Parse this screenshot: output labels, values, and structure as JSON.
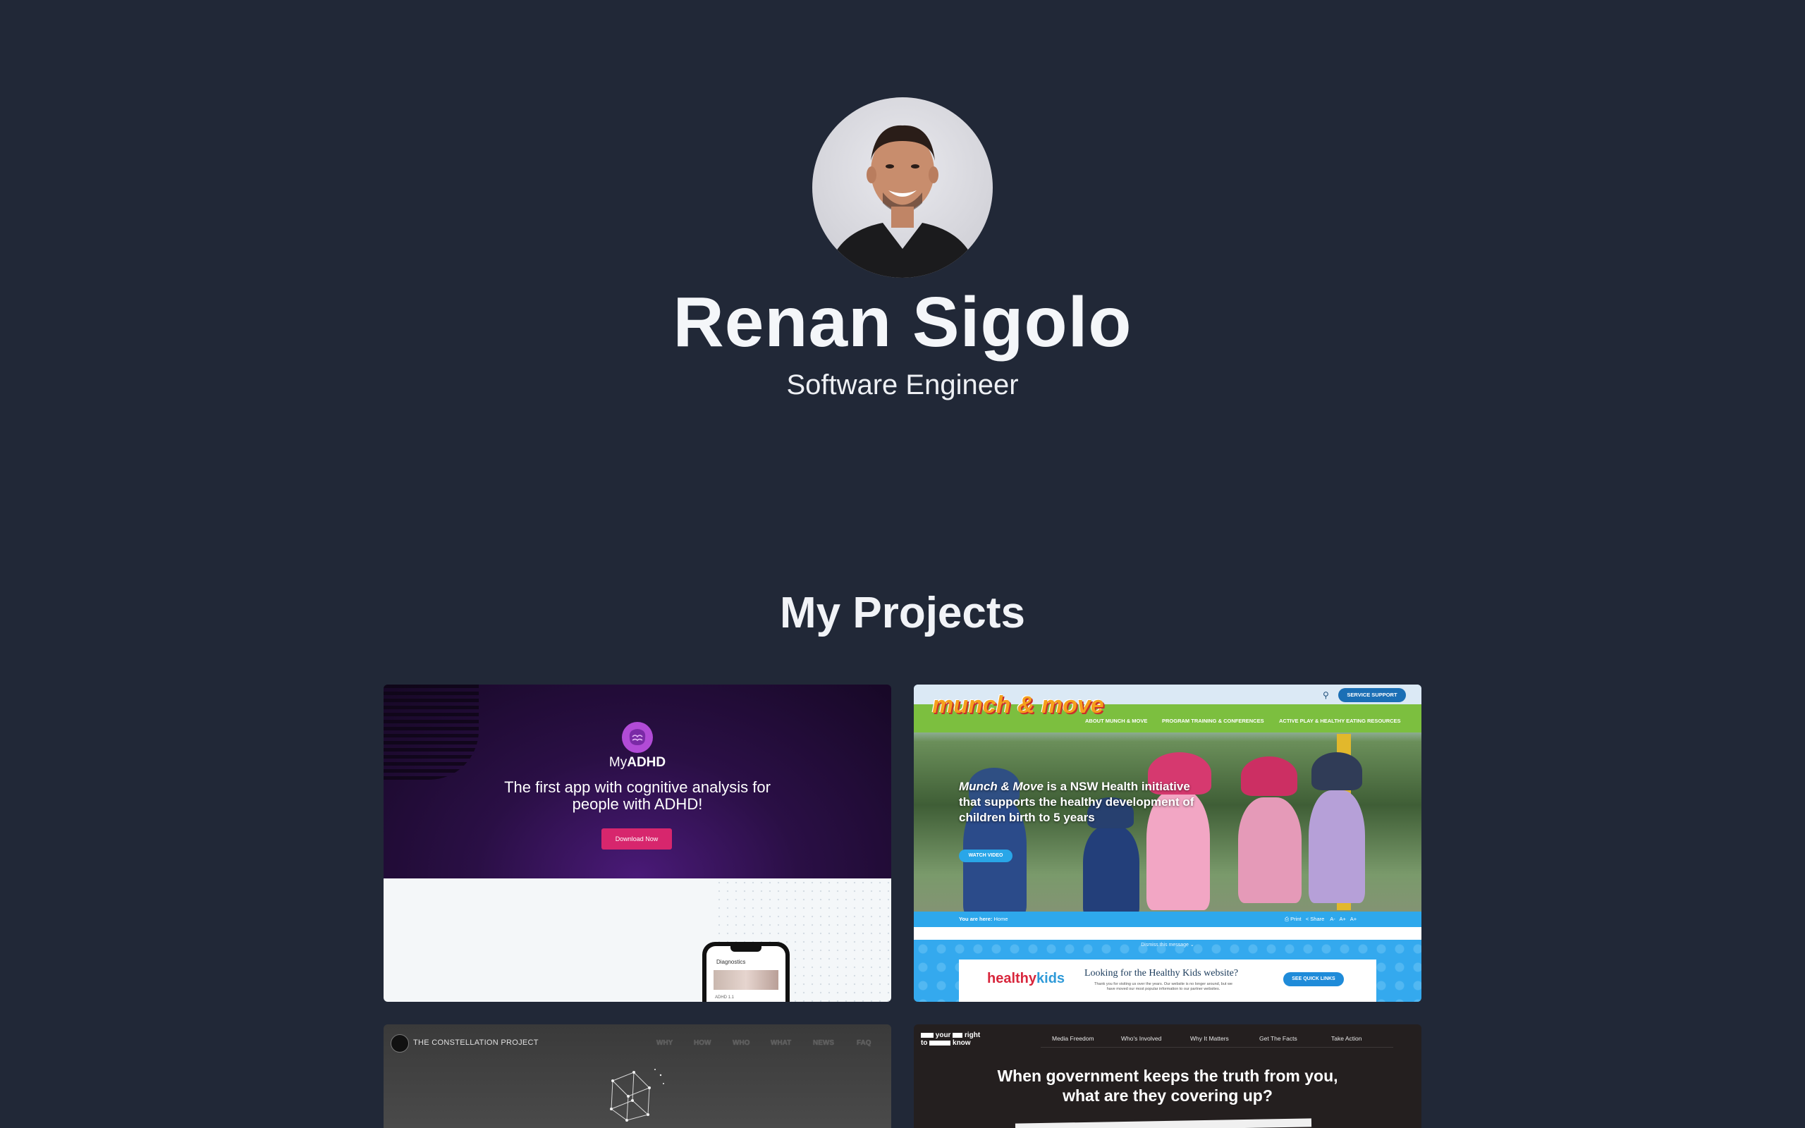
{
  "profile": {
    "name": "Renan Sigolo",
    "title": "Software Engineer",
    "avatar_icon": "portrait-photo"
  },
  "projects_section": {
    "title": "My Projects"
  },
  "projects": [
    {
      "brand_prefix": "My",
      "brand_suffix": "ADHD",
      "headline": "The first app with cognitive analysis for people with ADHD!",
      "button": "Download Now",
      "phone_label": "Diagnostics",
      "phone_small": "ADHD 1.1"
    },
    {
      "logo": "munch & move",
      "nav": [
        "ABOUT MUNCH & MOVE",
        "PROGRAM TRAINING & CONFERENCES",
        "ACTIVE PLAY & HEALTHY EATING RESOURCES"
      ],
      "support_button": "SERVICE SUPPORT",
      "headline_em": "Munch & Move",
      "headline_rest": " is a NSW Health initiative that supports the healthy development of children birth to 5 years",
      "video_button": "WATCH VIDEO",
      "breadcrumb_label": "You are here:",
      "breadcrumb_value": "Home",
      "tools": [
        "Print",
        "Share",
        "A-",
        "A+",
        "A+"
      ],
      "dismiss": "Dismiss this message",
      "hk_logo_a": "healthy",
      "hk_logo_b": "kids",
      "hk_title": "Looking for the Healthy Kids website?",
      "hk_sub": "Thank you for visiting us over the years. Our website is no longer around, but we have moved our most popular information to our partner websites.",
      "hk_button": "SEE QUICK LINKS"
    },
    {
      "title": "THE CONSTELLATION PROJECT",
      "nav": [
        "WHY",
        "HOW",
        "WHO",
        "WHAT",
        "NEWS",
        "FAQ"
      ]
    },
    {
      "logo_words": [
        "your",
        "right",
        "to",
        "know"
      ],
      "nav": [
        "Media Freedom",
        "Who's Involved",
        "Why It Matters",
        "Get The Facts",
        "Take Action"
      ],
      "headline_line1": "When government keeps the truth from you,",
      "headline_line2": "what are they covering up?"
    }
  ]
}
